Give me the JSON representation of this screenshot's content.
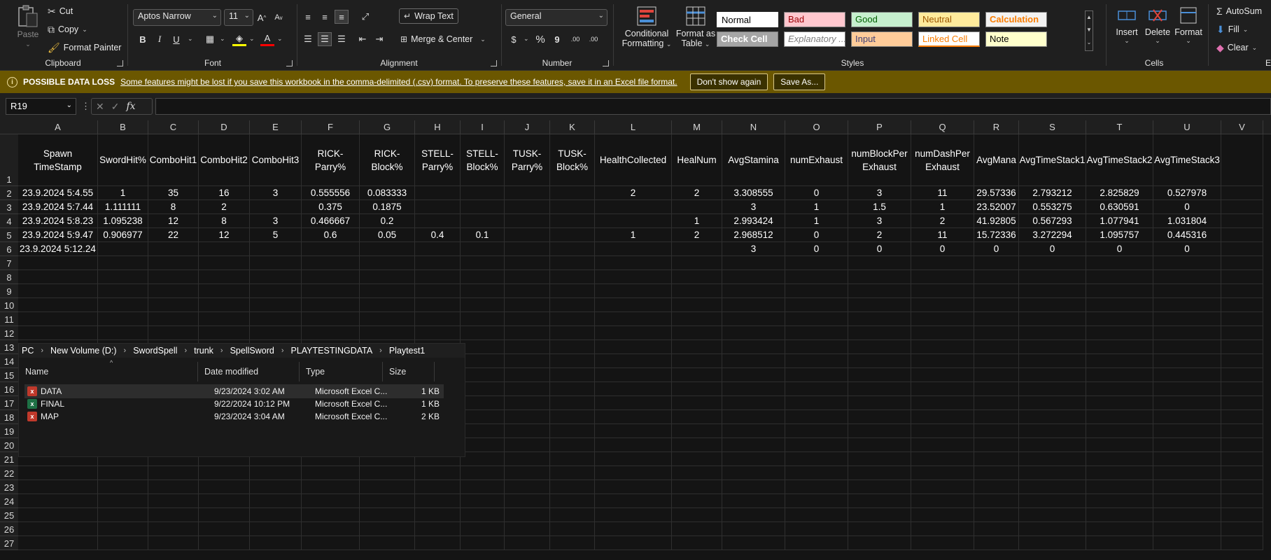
{
  "ribbon": {
    "clipboard": {
      "label": "Clipboard",
      "paste": "Paste",
      "cut": "Cut",
      "copy": "Copy",
      "format_painter": "Format Painter"
    },
    "font": {
      "label": "Font",
      "family": "Aptos Narrow",
      "size": "11"
    },
    "alignment": {
      "label": "Alignment",
      "wrap_text": "Wrap Text",
      "merge_center": "Merge & Center"
    },
    "number": {
      "label": "Number",
      "format": "General",
      "currency": "$",
      "percent": "%",
      "comma": "9",
      "inc_decimal": ".00",
      "dec_decimal": ".00"
    },
    "styles": {
      "label": "Styles",
      "conditional_formatting": [
        "Conditional",
        "Formatting"
      ],
      "format_as_table": [
        "Format as",
        "Table"
      ],
      "cells": [
        {
          "text": "Normal",
          "bg": "#ffffff",
          "fg": "#000000"
        },
        {
          "text": "Bad",
          "bg": "#ffc7ce",
          "fg": "#9c0006"
        },
        {
          "text": "Good",
          "bg": "#c6efce",
          "fg": "#006100"
        },
        {
          "text": "Neutral",
          "bg": "#ffeb9c",
          "fg": "#9c5700"
        },
        {
          "text": "Calculation",
          "bg": "#f2f2f2",
          "fg": "#fa7d00"
        },
        {
          "text": "Check Cell",
          "bg": "#a5a5a5",
          "fg": "#ffffff"
        },
        {
          "text": "Explanatory ...",
          "bg": "#ffffff",
          "fg": "#7f7f7f"
        },
        {
          "text": "Input",
          "bg": "#ffcc99",
          "fg": "#3f3f76"
        },
        {
          "text": "Linked Cell",
          "bg": "#ffffff",
          "fg": "#fa7d00"
        },
        {
          "text": "Note",
          "bg": "#ffffcc",
          "fg": "#000000"
        }
      ]
    },
    "cells_group": {
      "label": "Cells",
      "insert": "Insert",
      "delete": "Delete",
      "format": "Format"
    },
    "editing": {
      "autosum": "AutoSum",
      "fill": "Fill",
      "clear": "Clear",
      "label_partial": "E"
    }
  },
  "message_bar": {
    "title": "POSSIBLE DATA LOSS",
    "text": "Some features might be lost if you save this workbook in the comma-delimited (.csv) format. To preserve these features, save it in an Excel file format.",
    "dont_show": "Don't show again",
    "save_as": "Save As..."
  },
  "formula_bar": {
    "name_box": "R19",
    "fx": "fx",
    "formula": ""
  },
  "sheet": {
    "columns": [
      "A",
      "B",
      "C",
      "D",
      "E",
      "F",
      "G",
      "H",
      "I",
      "J",
      "K",
      "L",
      "M",
      "N",
      "O",
      "P",
      "Q",
      "R",
      "S",
      "T",
      "U",
      "V"
    ],
    "rows": [
      "1",
      "2",
      "3",
      "4",
      "5",
      "6",
      "7",
      "8",
      "9",
      "10",
      "11",
      "12",
      "13",
      "14",
      "15",
      "16",
      "17",
      "18",
      "19",
      "20",
      "21",
      "22",
      "23",
      "24",
      "25",
      "26",
      "27"
    ],
    "header_row": [
      "Spawn TimeStamp",
      "SwordHit%",
      "ComboHit1",
      "ComboHit2",
      "ComboHit3",
      "RICK-Parry%",
      "RICK-Block%",
      "STELL-Parry%",
      "STELL-Block%",
      "TUSK-Parry%",
      "TUSK-Block%",
      "HealthCollected",
      "HealNum",
      "AvgStamina",
      "numExhaust",
      "numBlockPer Exhaust",
      "numDashPer Exhaust",
      "AvgMana",
      "AvgTimeStack1",
      "AvgTimeStack2",
      "AvgTimeStack3",
      ""
    ],
    "data_rows": [
      [
        "23.9.2024  5:4.55",
        "1",
        "35",
        "16",
        "3",
        "0.555556",
        "0.083333",
        "",
        "",
        "",
        "",
        "2",
        "2",
        "3.308555",
        "0",
        "3",
        "11",
        "29.57336",
        "2.793212",
        "2.825829",
        "0.527978",
        ""
      ],
      [
        "23.9.2024  5:7.44",
        "1.111111",
        "8",
        "2",
        "",
        "0.375",
        "0.1875",
        "",
        "",
        "",
        "",
        "",
        "",
        "3",
        "1",
        "1.5",
        "1",
        "23.52007",
        "0.553275",
        "0.630591",
        "0",
        ""
      ],
      [
        "23.9.2024  5:8.23",
        "1.095238",
        "12",
        "8",
        "3",
        "0.466667",
        "0.2",
        "",
        "",
        "",
        "",
        "",
        "1",
        "2.993424",
        "1",
        "3",
        "2",
        "41.92805",
        "0.567293",
        "1.077941",
        "1.031804",
        ""
      ],
      [
        "23.9.2024  5:9.47",
        "0.906977",
        "22",
        "12",
        "5",
        "0.6",
        "0.05",
        "0.4",
        "0.1",
        "",
        "",
        "1",
        "2",
        "2.968512",
        "0",
        "2",
        "11",
        "15.72336",
        "3.272294",
        "1.095757",
        "0.445316",
        ""
      ],
      [
        "23.9.2024  5:12.24",
        "",
        "",
        "",
        "",
        "",
        "",
        "",
        "",
        "",
        "",
        "",
        "",
        "3",
        "0",
        "0",
        "0",
        "0",
        "0",
        "0",
        "0",
        ""
      ]
    ]
  },
  "explorer": {
    "breadcrumbs": [
      "PC",
      "New Volume (D:)",
      "SwordSpell",
      "trunk",
      "SpellSword",
      "PLAYTESTINGDATA",
      "Playtest1"
    ],
    "columns": [
      "Name",
      "Date modified",
      "Type",
      "Size"
    ],
    "files": [
      {
        "name": "DATA",
        "date": "9/23/2024 3:02 AM",
        "type": "Microsoft Excel C...",
        "size": "1 KB",
        "icon_color": "#c0392b"
      },
      {
        "name": "FINAL",
        "date": "9/22/2024 10:12 PM",
        "type": "Microsoft Excel C...",
        "size": "1 KB",
        "icon_color": "#1e7145"
      },
      {
        "name": "MAP",
        "date": "9/23/2024 3:04 AM",
        "type": "Microsoft Excel C...",
        "size": "2 KB",
        "icon_color": "#c0392b"
      }
    ]
  }
}
